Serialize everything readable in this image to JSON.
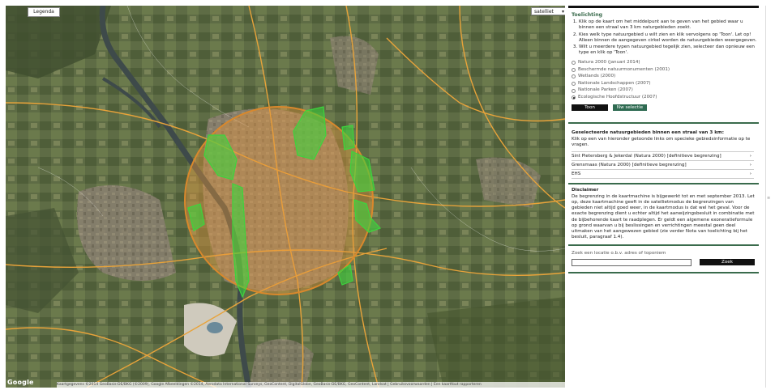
{
  "map": {
    "legend_button": "Legenda",
    "map_type": "satelliet",
    "google_logo": "Google",
    "attribution": "Kaartgegevens ©2014 GeoBasis-DE/BKG (©2009), Google Afbeeldingen ©2014, Aerodata International Surveys, GeoContent, DigitalGlobe, GeoBasis-DE/BKG, GeoContent, Landsat | Gebruiksvoorwaarden | Een kaartfout rapporteren",
    "colors": {
      "radius_fill": "#e8963c",
      "radius_stroke": "#d9882c",
      "nature_area": "#3dd43d",
      "road": "#e8a33a"
    }
  },
  "sidebar": {
    "title": "Toelichting",
    "steps": [
      "Klik op de kaart om het middelpunt aan te geven van het gebied waar u binnen een straal van 3 km naturgebieden zoekt.",
      "Kies welk type natuurgebied u wilt zien en klik vervolgens op 'Toon'. Let op! Alleen binnen de aangegeven cirkel worden de natuurgebieden weergegeven.",
      "Wilt u meerdere typen natuurgebied tegelijk zien, selecteer dan opnieuw een type en klik op 'Toon'."
    ],
    "radio_options": [
      "Natura 2000 (januari 2014)",
      "Beschermde natuurmonumenten (2001)",
      "Wetlands (2000)",
      "Nationale Landschappen (2007)",
      "Nationale Parken (2007)",
      "Ecologische Hoofdstructuur (2007)"
    ],
    "selected_option": "Ecologische Hoofdstructuur (2007)",
    "show_button": "Toon",
    "new_selection_button": "Nw selectie",
    "selected_title": "Geselecteerde natuurgebieden binnen een straal van 3 km:",
    "selected_intro": "Klik op een van hieronder getoonde links om specieke gebiedsinformatie op te vragen.",
    "results": [
      "Sint Pietersberg & Jekerdal (Natura 2000) [definitieve begrenzing]",
      "Grensmaas (Natura 2000) [definitieve begrenzing]",
      "EHS"
    ],
    "disclaimer_title": "Disclaimer",
    "disclaimer_text": "De begrenzing in de kaartmachine is bijgewerkt tot en met september 2013. Let op, deze kaartmachine geeft in de satellietmodus de begrenzingen van gebieden niet altijd goed weer, in de kaartmodus is dat wel het geval. Voor de exacte begrenzing dient u echter altijd het aanwijzingsbesluit in combinatie met de bijbehorende kaart te raadplegen. Er geldt een algemene exoneratieformule op grond waarvan u bij beslissingen en verrichtingen meestal geen deel uitmaken van het aangewezen gebied (zie verder Nota van toelichting bij het besluit, paragraaf 1.4).",
    "search_label": "Zoek een locatie o.b.v. adres of toponiem",
    "search_value": "",
    "search_button": "Zoek"
  }
}
